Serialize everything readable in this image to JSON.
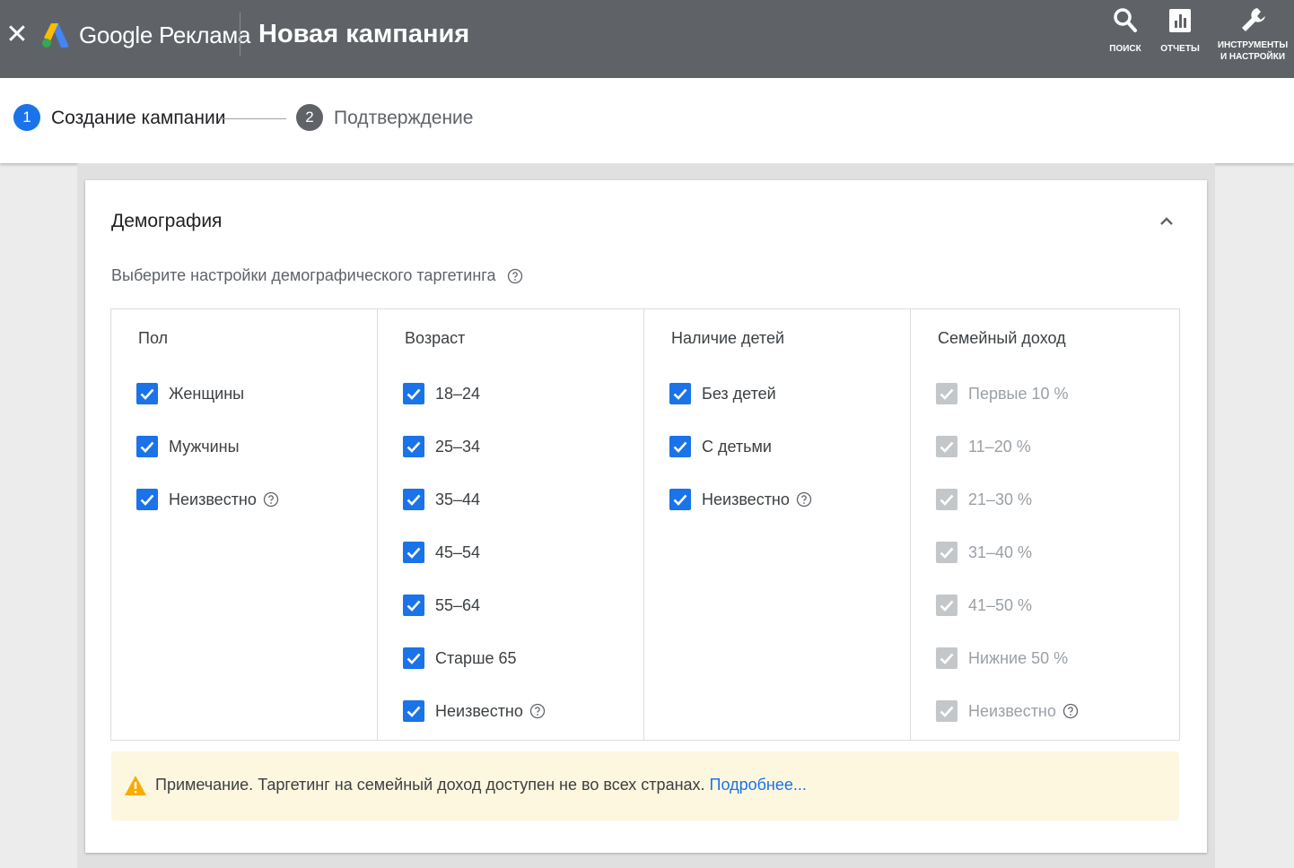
{
  "header": {
    "close_glyph": "✕",
    "brand": "Google Реклама",
    "title": "Новая кампания",
    "tools": [
      {
        "icon": "search-icon",
        "label": "ПОИСК"
      },
      {
        "icon": "reports-icon",
        "label": "ОТЧЕТЫ"
      },
      {
        "icon": "wrench-icon",
        "label_line1": "ИНСТРУМЕНТЫ",
        "label_line2": "И НАСТРОЙКИ"
      }
    ]
  },
  "stepper": {
    "steps": [
      {
        "number": "1",
        "label": "Создание кампании",
        "active": true
      },
      {
        "number": "2",
        "label": "Подтверждение",
        "active": false
      }
    ]
  },
  "section": {
    "title": "Демография",
    "subtitle": "Выберите настройки демографического таргетинга",
    "columns": [
      {
        "header": "Пол",
        "options": [
          {
            "label": "Женщины",
            "checked": true
          },
          {
            "label": "Мужчины",
            "checked": true
          },
          {
            "label": "Неизвестно",
            "checked": true,
            "help": true
          }
        ]
      },
      {
        "header": "Возраст",
        "options": [
          {
            "label": "18–24",
            "checked": true
          },
          {
            "label": "25–34",
            "checked": true
          },
          {
            "label": "35–44",
            "checked": true
          },
          {
            "label": "45–54",
            "checked": true
          },
          {
            "label": "55–64",
            "checked": true
          },
          {
            "label": "Старше 65",
            "checked": true
          },
          {
            "label": "Неизвестно",
            "checked": true,
            "help": true
          }
        ]
      },
      {
        "header": "Наличие детей",
        "options": [
          {
            "label": "Без детей",
            "checked": true
          },
          {
            "label": "С детьми",
            "checked": true
          },
          {
            "label": "Неизвестно",
            "checked": true,
            "help": true
          }
        ]
      },
      {
        "header": "Семейный доход",
        "options": [
          {
            "label": "Первые 10 %",
            "checked": true,
            "disabled": true
          },
          {
            "label": "11–20 %",
            "checked": true,
            "disabled": true
          },
          {
            "label": "21–30 %",
            "checked": true,
            "disabled": true
          },
          {
            "label": "31–40 %",
            "checked": true,
            "disabled": true
          },
          {
            "label": "41–50 %",
            "checked": true,
            "disabled": true
          },
          {
            "label": "Нижние 50 %",
            "checked": true,
            "disabled": true
          },
          {
            "label": "Неизвестно",
            "checked": true,
            "disabled": true,
            "help": true
          }
        ]
      }
    ]
  },
  "note": {
    "text": "Примечание. Таргетинг на семейный доход доступен не во всех странах.",
    "link": "Подробнее..."
  },
  "colors": {
    "header_bg": "#5f6368",
    "accent": "#1a73e8",
    "checkbox_disabled": "#c4c7c9",
    "note_bg": "#fef7e0",
    "warning": "#f9ab00"
  }
}
